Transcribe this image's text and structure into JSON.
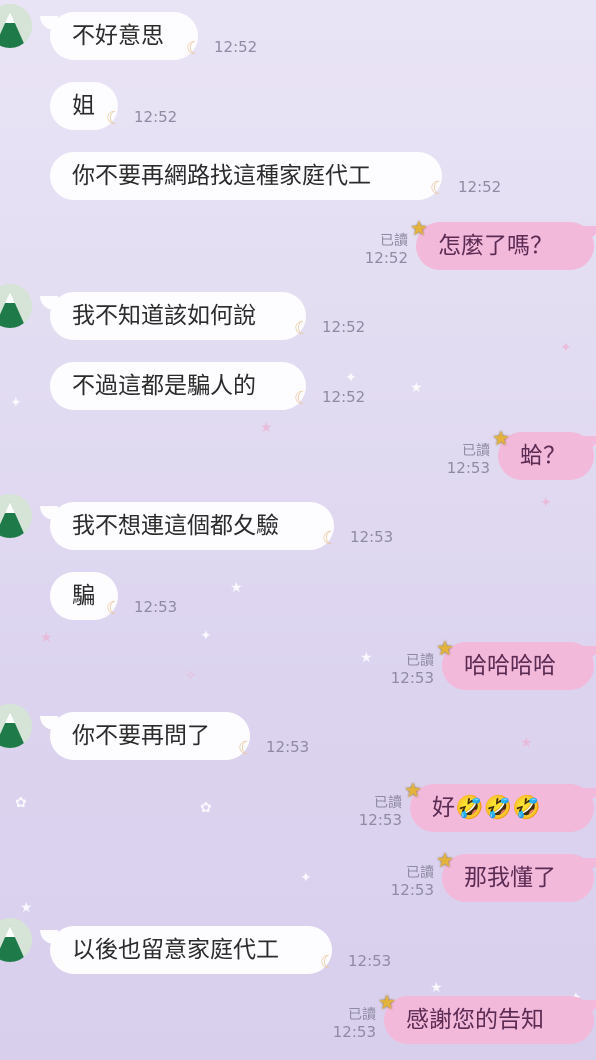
{
  "read_label": "已讀",
  "messages": [
    {
      "dir": "in",
      "text": "不好意思",
      "time": "12:52",
      "avatar": true
    },
    {
      "dir": "in",
      "text": "姐",
      "time": "12:52"
    },
    {
      "dir": "in",
      "text": "你不要再網路找這種家庭代工",
      "time": "12:52"
    },
    {
      "dir": "out",
      "text": "怎麼了嗎？",
      "time": "12:52",
      "read": true
    },
    {
      "dir": "in",
      "text": "我不知道該如何說",
      "time": "12:52",
      "avatar": true
    },
    {
      "dir": "in",
      "text": "不過這都是騙人的",
      "time": "12:52"
    },
    {
      "dir": "out",
      "text": "蛤？",
      "time": "12:53",
      "read": true
    },
    {
      "dir": "in",
      "text": "我不想連這個都夂驗",
      "time": "12:53",
      "avatar": true
    },
    {
      "dir": "in",
      "text": "騙",
      "time": "12:53"
    },
    {
      "dir": "out",
      "text": "哈哈哈哈",
      "time": "12:53",
      "read": true
    },
    {
      "dir": "in",
      "text": "你不要再問了",
      "time": "12:53",
      "avatar": true
    },
    {
      "dir": "out",
      "text": "好🤣🤣🤣",
      "time": "12:53",
      "read": true
    },
    {
      "dir": "out",
      "text": "那我懂了",
      "time": "12:53",
      "read": true
    },
    {
      "dir": "in",
      "text": "以後也留意家庭代工",
      "time": "12:53",
      "avatar": true
    },
    {
      "dir": "out",
      "text": "感謝您的告知",
      "time": "12:53",
      "read": true
    }
  ]
}
